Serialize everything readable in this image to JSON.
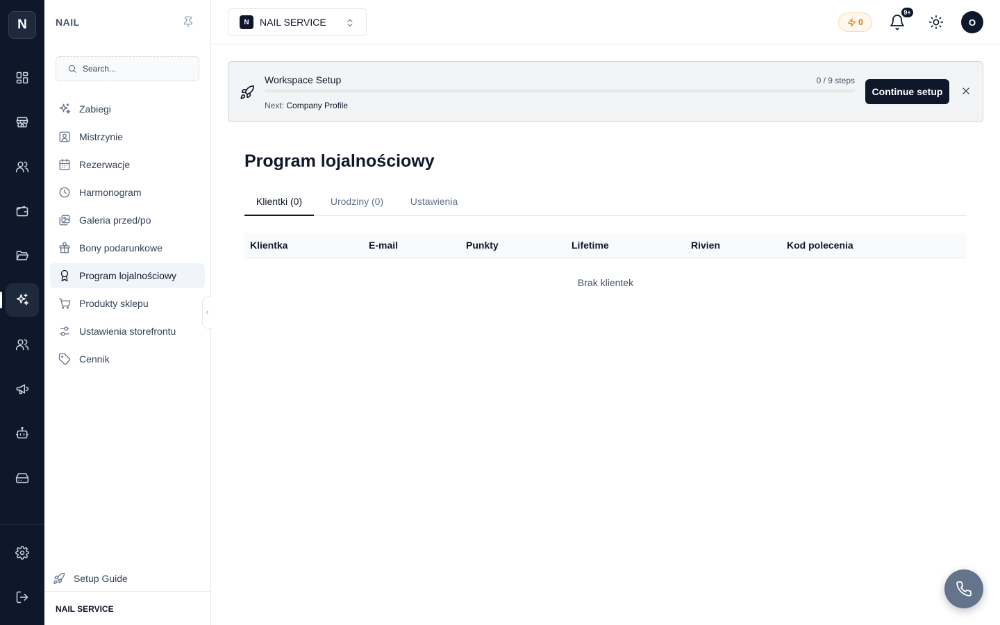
{
  "rail": {
    "logo": "N",
    "items": [
      {
        "icon": "dashboard-icon"
      },
      {
        "icon": "store-icon"
      },
      {
        "icon": "users-icon"
      },
      {
        "icon": "wallet-icon"
      },
      {
        "icon": "folder-icon"
      },
      {
        "icon": "sparkles-icon",
        "active": true
      },
      {
        "icon": "team-icon"
      },
      {
        "icon": "megaphone-icon"
      },
      {
        "icon": "bot-icon"
      },
      {
        "icon": "storage-icon"
      }
    ],
    "bottom": [
      {
        "icon": "settings-icon"
      },
      {
        "icon": "logout-icon"
      }
    ]
  },
  "sidebar": {
    "brand": "NAIL",
    "search_placeholder": "Search...",
    "items": [
      {
        "label": "Zabiegi",
        "icon": "sparkles-icon"
      },
      {
        "label": "Mistrzynie",
        "icon": "user-square-icon"
      },
      {
        "label": "Rezerwacje",
        "icon": "calendar-icon"
      },
      {
        "label": "Harmonogram",
        "icon": "clock-icon"
      },
      {
        "label": "Galeria przed/po",
        "icon": "gallery-icon"
      },
      {
        "label": "Bony podarunkowe",
        "icon": "gift-icon"
      },
      {
        "label": "Program lojalnościowy",
        "icon": "award-icon",
        "active": true
      },
      {
        "label": "Produkty sklepu",
        "icon": "cart-icon"
      },
      {
        "label": "Ustawienia storefrontu",
        "icon": "sliders-icon"
      },
      {
        "label": "Cennik",
        "icon": "tag-icon"
      }
    ],
    "setup_guide": "Setup Guide",
    "footer": "NAIL SERVICE"
  },
  "header": {
    "workspace_badge": "N",
    "workspace_name": "NAIL SERVICE",
    "credits": "0",
    "notifications": "9+",
    "avatar": "O"
  },
  "setup": {
    "title": "Workspace Setup",
    "steps": "0 / 9 steps",
    "progress": 0,
    "next_label": "Next:",
    "next_value": "Company Profile",
    "button": "Continue setup"
  },
  "main": {
    "title": "Program lojalnościowy",
    "tabs": [
      {
        "label": "Klientki (0)",
        "active": true
      },
      {
        "label": "Urodziny (0)"
      },
      {
        "label": "Ustawienia"
      }
    ],
    "columns": [
      "Klientka",
      "E-mail",
      "Punkty",
      "Lifetime",
      "Rivien",
      "Kod polecenia"
    ],
    "empty_text": "Brak klientek"
  },
  "colors": {
    "rail_bg": "#0f172a",
    "accent": "#0f172a",
    "credits": "#d97706",
    "fab": "#64748b"
  }
}
